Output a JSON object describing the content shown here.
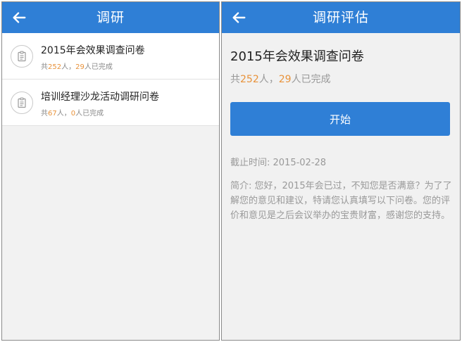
{
  "left": {
    "header": {
      "back_icon": "arrow-left-icon",
      "title": "调研"
    },
    "surveys": [
      {
        "icon": "clipboard-icon",
        "title": "2015年会效果调查问卷",
        "meta_prefix": "共",
        "total": "252",
        "meta_mid": "人，",
        "completed": "29",
        "meta_suffix": "人已完成"
      },
      {
        "icon": "clipboard-icon",
        "title": "培训经理沙龙活动调研问卷",
        "meta_prefix": "共",
        "total": "67",
        "meta_mid": "人，",
        "completed": "0",
        "meta_suffix": "人已完成"
      }
    ]
  },
  "right": {
    "header": {
      "back_icon": "arrow-left-icon",
      "title": "调研评估"
    },
    "detail": {
      "title": "2015年会效果调查问卷",
      "meta_prefix": "共",
      "total": "252",
      "meta_mid": "人，",
      "completed": "29",
      "meta_suffix": "人已完成",
      "start_label": "开始",
      "deadline": "截止时间: 2015-02-28",
      "intro": "简介: 您好，2015年会已过，不知您是否满意？为了了解您的意见和建议，特请您认真填写以下问卷。您的评价和意见是之后会议举办的宝贵财富，感谢您的支持。"
    }
  },
  "colors": {
    "header": "#2f7fd6",
    "highlight_number": "#e8923a",
    "muted_text": "#999999"
  }
}
